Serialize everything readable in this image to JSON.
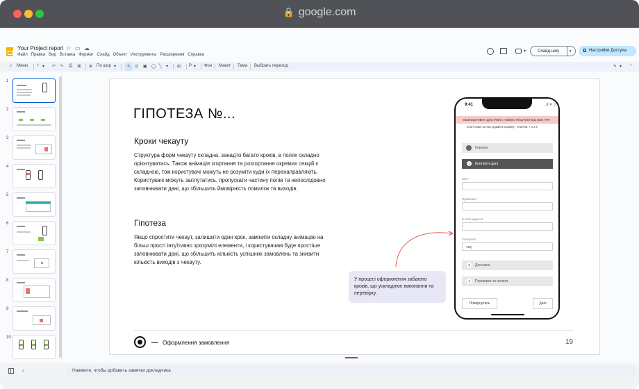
{
  "browser": {
    "url": "google.com"
  },
  "app": {
    "doc_title": "Your Project report",
    "menu": [
      "Файл",
      "Правка",
      "Вид",
      "Вставка",
      "Формат",
      "Слайд",
      "Объект",
      "Инструменты",
      "Расширения",
      "Справка"
    ],
    "slideshow_label": "Слайд-шоу",
    "access_label": "Настройки Доступа"
  },
  "toolbar": {
    "menu_label": "Меню",
    "fit_label": "По шир",
    "background_label": "Фон",
    "layout_label": "Макет",
    "theme_label": "Тема",
    "transition_label": "Выбрать переход"
  },
  "thumbnails": [
    "1",
    "2",
    "3",
    "4",
    "5",
    "6",
    "7",
    "8",
    "9",
    "10"
  ],
  "slide": {
    "title": "ГІПОТЕЗА №...",
    "section1_heading": "Кроки чекауту",
    "section1_text": "Структура форм чекауту складна, занадто багато кроків, в полях складно орієнтуватись. Також анімація згортання та розгортання окремих секцій є складною, тож користувачі можуть не розуміти куди їх перенаправляють. Користувачі можуть заплутатись, пропускати частину полів та непослідовно заповнювати дані, що збільшить ймовірність помилок та виходів.",
    "section2_heading": "Гіпотеза",
    "section2_text": "Якщо спростити чекаут, залишити один крок,  замінити складну анімацію на більш прості інтуїтивно зрозумілі елементи, і користувачам буде простіше заповнювати дані, що збільшить кількість успішних замовлень та знизити кількість виходів з чекауту.",
    "callout": "У процесі оформлення забагато кроків, що ускладнює виконання та перевірку.",
    "footer_text": "Оформлення замовлення",
    "page_number": "19"
  },
  "phone": {
    "time": "9:41",
    "status": "..ıl ᯤ ▭",
    "banner": "БЕЗКОШТОВНА ДОСТАВКА НОВОЮ ПОШТОЮ ВІД 1500 ГРН",
    "promo": "платі лише за три, додай в корзину - платі 81 7 а 1 8",
    "steps": [
      {
        "label": "Корзина"
      },
      {
        "label": "Контактні дані",
        "num": "2"
      },
      {
        "label": "Доставка",
        "num": "3"
      },
      {
        "label": "Перевірка та оплата",
        "num": "4"
      }
    ],
    "fields": [
      {
        "label": "Ім'я",
        "value": ""
      },
      {
        "label": "Прізвище",
        "value": ""
      },
      {
        "label": "E-mail адреса",
        "value": ""
      },
      {
        "label": "Телефон",
        "value": "+38("
      }
    ],
    "back_label": "Повернутись",
    "next_label": "Далі"
  },
  "notes": {
    "placeholder": "Нажмите, чтобы добавить заметки докладчика"
  }
}
